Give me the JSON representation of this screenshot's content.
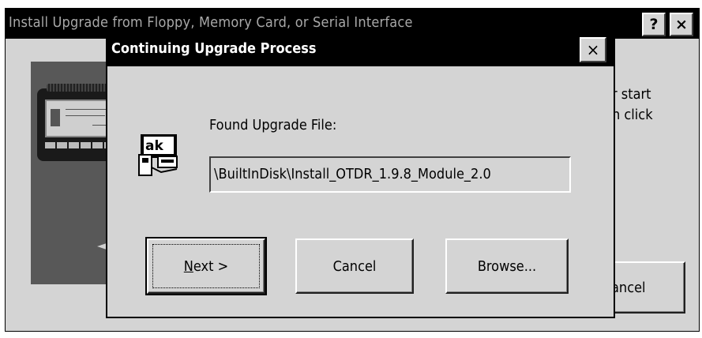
{
  "background_window": {
    "title": "Install Upgrade from Floppy, Memory Card, or Serial Interface",
    "help_label": "?",
    "close_label": "×",
    "text_line_1": "r start",
    "text_line_2": "n click",
    "cancel_label": "ancel"
  },
  "dialog": {
    "title": "Continuing Upgrade Process",
    "close_label": "×",
    "icon": "disk-icon",
    "found_label": "Found Upgrade File:",
    "file_path": "\\BuiltInDisk\\Install_OTDR_1.9.8_Module_2.0",
    "buttons": {
      "next_mnemonic": "N",
      "next_rest": "ext >",
      "cancel": "Cancel",
      "browse": "Browse..."
    }
  },
  "colors": {
    "face": "#d4d4d4",
    "titlebar": "#000000",
    "inactive_title_text": "#a8a8a8",
    "active_title_text": "#ffffff"
  }
}
